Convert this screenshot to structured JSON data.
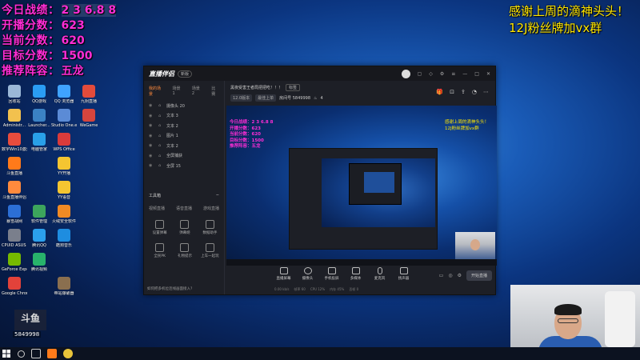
{
  "overlay": {
    "stats": [
      {
        "label": "今日战绩：",
        "value": "2 3 6.8 8"
      },
      {
        "label": "开播分数：",
        "value": "623"
      },
      {
        "label": "当前分数：",
        "value": "620"
      },
      {
        "label": "目标分数：",
        "value": "1500"
      },
      {
        "label": "推荐阵容：",
        "value": "五龙"
      }
    ],
    "thanks_line1": "感谢上周的滴神头头！",
    "thanks_line2": "12J粉丝牌加vx群"
  },
  "desktop_icons": [
    {
      "label": "回收站",
      "color": "#9bb8d8"
    },
    {
      "label": "QQ游戏",
      "color": "#2a9df4"
    },
    {
      "label": "QQ 浏览器",
      "color": "#3fa3ff"
    },
    {
      "label": "九阴直播",
      "color": "#e34b3b"
    },
    {
      "label": "Administr...",
      "color": "#f2c14e"
    },
    {
      "label": "Launcher...",
      "color": "#3b82c4"
    },
    {
      "label": "Studio One.exe",
      "color": "#5b8bd6"
    },
    {
      "label": "WeGame",
      "color": "#d6453d"
    },
    {
      "label": "数字Win10激活",
      "color": "#e84c3d"
    },
    {
      "label": "电脑管家",
      "color": "#29a0e8"
    },
    {
      "label": "WPS Office",
      "color": "#d93b3b"
    },
    {
      "label": "斗鱼直播",
      "color": "#ff7a1a"
    },
    {
      "label": "YY开播",
      "color": "#f4c531"
    },
    {
      "label": "斗鱼直播伴侣",
      "color": "#ff8a3d"
    },
    {
      "label": "YY语音",
      "color": "#f4c531"
    },
    {
      "label": "暴雪战网",
      "color": "#2c6fd6"
    },
    {
      "label": "软件管理",
      "color": "#3ca55c"
    },
    {
      "label": "火绒安全软件",
      "color": "#f08a24"
    },
    {
      "label": "CPUID ASUS CPU-Z",
      "color": "#7a7f8c"
    },
    {
      "label": "腾讯QQ",
      "color": "#2ba0ec"
    },
    {
      "label": "酷狗音乐",
      "color": "#1e8de0"
    },
    {
      "label": "GeForce Experience",
      "color": "#76b900"
    },
    {
      "label": "腾讯视频",
      "color": "#28b36b"
    },
    {
      "label": "Google Chrome",
      "color": "#e2423a"
    },
    {
      "label": "帝站爆破器",
      "color": "#8a6f4f"
    }
  ],
  "app": {
    "logo": "直播伴侣",
    "badge": "新版",
    "scene_tabs": [
      "我的场景",
      "场景 1",
      "场景 2",
      "比赛"
    ],
    "sources": [
      {
        "label": "摄像头 20"
      },
      {
        "label": "文本 3"
      },
      {
        "label": "文本 2"
      },
      {
        "label": "图片 1"
      },
      {
        "label": "文本 2"
      },
      {
        "label": "全屏捕获"
      },
      {
        "label": "全屏 15"
      }
    ],
    "tools_title": "工具箱",
    "tools_tabs": [
      "视频直播",
      "语音直播",
      "游戏直播"
    ],
    "tools": [
      {
        "label": "设置弹幕"
      },
      {
        "label": "弹幕姬"
      },
      {
        "label": "数据助手"
      },
      {
        "label": "全民PK"
      },
      {
        "label": "礼物提示"
      },
      {
        "label": "上车一起玩"
      }
    ],
    "left_footer": "如何把多机位连线画面接入?",
    "room_title": "黑夜受害王者局把把吃！！！",
    "room_tag": "标签",
    "room_chips": [
      "12.0版本",
      "最佳上单"
    ],
    "room_id": "房间号 5849998",
    "room_hot": "4",
    "preview": {
      "stats": [
        "今日战绩：2 3 6.8 8",
        "开播分数：623",
        "当前分数：620",
        "目标分数：1500",
        "推荐阵容：五龙"
      ],
      "thanks_line1": "感谢上周的滴神头头！",
      "thanks_line2": "12J粉丝牌加vx群"
    },
    "controls": [
      {
        "label": "直播屏幕"
      },
      {
        "label": "摄像头"
      },
      {
        "label": "手机投屏"
      },
      {
        "label": "多媒体"
      },
      {
        "label": "麦克风"
      },
      {
        "label": "扬声器"
      }
    ],
    "start_label": "开始直播",
    "status_items": [
      "0.00 kb/s",
      "帧率 60",
      "CPU 12%",
      "内存 45%",
      "丢帧 0"
    ]
  },
  "taskbar": {
    "watermark_id": "5849998",
    "brand": "斗鱼"
  }
}
